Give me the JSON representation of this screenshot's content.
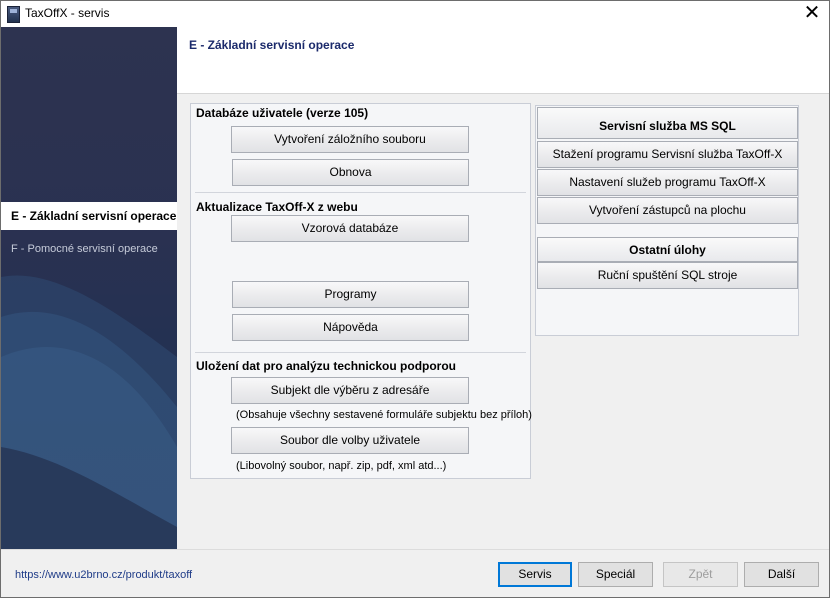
{
  "window": {
    "title": "TaxOffX - servis",
    "close_symbol": "✕"
  },
  "sidebar": {
    "items": [
      {
        "label": "E - Základní servisní operace",
        "active": true
      },
      {
        "label": "F - Pomocné servisní operace",
        "active": false
      }
    ]
  },
  "header": {
    "title": "E - Základní servisní operace"
  },
  "left_panel": {
    "db_section": {
      "title": "Databáze uživatele (verze 105)",
      "buttons": [
        "Vytvoření záložního souboru",
        "Obnova"
      ]
    },
    "update_section": {
      "title": "Aktualizace TaxOff-X z webu",
      "buttons": [
        "Vzorová databáze",
        "Programy",
        "Nápověda"
      ]
    },
    "save_section": {
      "title": "Uložení dat pro analýzu technickou podporou",
      "buttons": [
        "Subjekt dle výběru z adresáře",
        "Soubor dle volby uživatele"
      ],
      "notes": [
        "(Obsahuje všechny sestavené formuláře subjektu bez příloh)",
        "(Libovolný soubor, např. zip, pdf, xml atd...)"
      ]
    }
  },
  "right_panel": {
    "sql_section": {
      "title": "Servisní služba MS SQL",
      "buttons": [
        "Stažení programu Servisní služba TaxOff-X",
        "Nastavení služeb programu TaxOff-X",
        "Vytvoření zástupců na plochu"
      ]
    },
    "other_section": {
      "title": "Ostatní úlohy",
      "buttons": [
        "Ruční spuštění SQL stroje"
      ]
    }
  },
  "footer": {
    "link": "https://www.u2brno.cz/produkt/taxoff",
    "buttons": {
      "servis": "Servis",
      "special": "Speciál",
      "back": "Zpět",
      "next": "Další"
    }
  }
}
